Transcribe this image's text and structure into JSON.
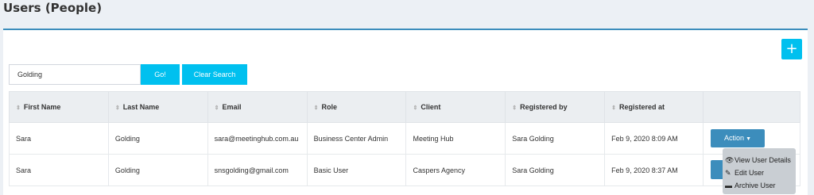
{
  "page": {
    "title": "Users (People)"
  },
  "toolbar": {
    "add_label": "+"
  },
  "search": {
    "value": "Golding",
    "go_label": "Go!",
    "clear_label": "Clear Search"
  },
  "table": {
    "columns": [
      "First Name",
      "Last Name",
      "Email",
      "Role",
      "Client",
      "Registered by",
      "Registered at"
    ],
    "rows": [
      {
        "first_name": "Sara",
        "last_name": "Golding",
        "email": "sara@meetinghub.com.au",
        "role": "Business Center Admin",
        "client": "Meeting Hub",
        "registered_by": "Sara Golding",
        "registered_at": "Feb 9, 2020 8:09 AM",
        "action": "Action"
      },
      {
        "first_name": "Sara",
        "last_name": "Golding",
        "email": "snsgolding@gmail.com",
        "role": "Basic User",
        "client": "Caspers Agency",
        "registered_by": "Sara Golding",
        "registered_at": "Feb 9, 2020 8:37 AM"
      }
    ]
  },
  "action_menu": {
    "items": [
      {
        "label": "View User Details",
        "icon": "eye-icon"
      },
      {
        "label": "Edit User",
        "icon": "edit-icon"
      },
      {
        "label": "Archive User",
        "icon": "archive-icon"
      }
    ]
  },
  "colors": {
    "primary": "#3c8dbc",
    "info": "#00c0ef",
    "header_bg": "#ebeef1",
    "page_bg": "#ecf0f5"
  }
}
